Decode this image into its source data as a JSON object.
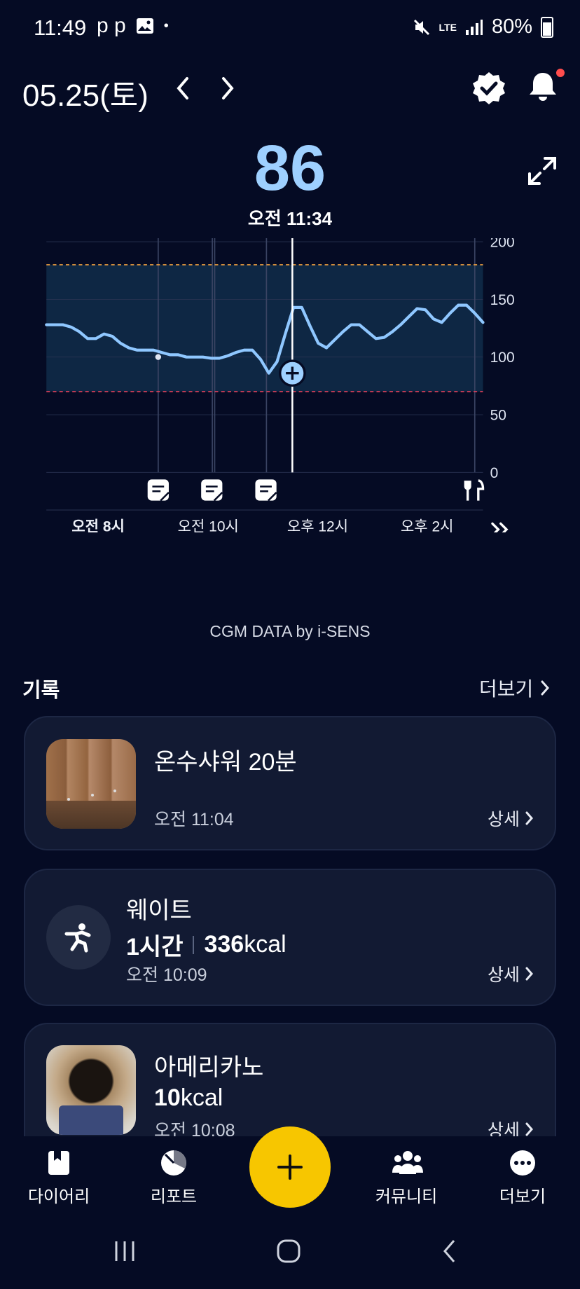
{
  "status_bar": {
    "time": "11:49",
    "left_icons": "p p",
    "network": "LTE",
    "battery": "80%"
  },
  "header": {
    "date": "05.25(토)"
  },
  "reading": {
    "value": "86",
    "time": "오전 11:34"
  },
  "chart_data": {
    "type": "line",
    "y_ticks": [
      "200",
      "150",
      "100",
      "50",
      "0"
    ],
    "ylim": [
      0,
      200
    ],
    "target_range": [
      70,
      180
    ],
    "x_labels": [
      "오전 8시",
      "오전 10시",
      "오후 12시",
      "오후 2시"
    ],
    "series": [
      {
        "values_mg_dl": [
          128,
          128,
          128,
          126,
          122,
          116,
          116,
          120,
          118,
          112,
          108,
          106,
          106,
          106,
          104,
          102,
          102,
          100,
          100,
          100,
          99,
          99,
          101,
          104,
          106,
          106,
          98,
          86,
          96,
          120,
          143,
          143,
          127,
          112,
          108,
          115,
          122,
          128,
          128,
          122,
          116,
          117,
          122,
          128,
          135,
          142,
          141,
          133,
          130,
          138,
          145,
          145,
          138,
          130
        ]
      }
    ],
    "cursor": {
      "value": 86,
      "time": "오전 11:34"
    },
    "markers": [
      "note",
      "note",
      "note",
      "meal"
    ],
    "grid": true
  },
  "cgm_source": "CGM DATA by i-SENS",
  "records": {
    "title": "기록",
    "more_label": "더보기",
    "detail_label": "상세",
    "items": [
      {
        "title": "온수샤워 20분",
        "time": "오전 11:04"
      },
      {
        "title": "웨이트",
        "duration": "1시간",
        "kcal_value": "336",
        "kcal_unit": "kcal",
        "time": "오전 10:09"
      },
      {
        "title": "아메리카노",
        "kcal_value": "10",
        "kcal_unit": "kcal",
        "time": "오전 10:08"
      }
    ]
  },
  "nav": {
    "items": [
      {
        "label": "다이어리",
        "icon": "book-icon"
      },
      {
        "label": "리포트",
        "icon": "report-icon"
      },
      {
        "label": "커뮤니티",
        "icon": "community-icon"
      },
      {
        "label": "더보기",
        "icon": "more-icon"
      }
    ],
    "fab_icon": "plus-icon"
  },
  "colors": {
    "background": "#050b24",
    "accent_value": "#9ed0ff",
    "fab": "#f7c600",
    "range_high": "#f0a040",
    "range_low": "#e8405a"
  }
}
